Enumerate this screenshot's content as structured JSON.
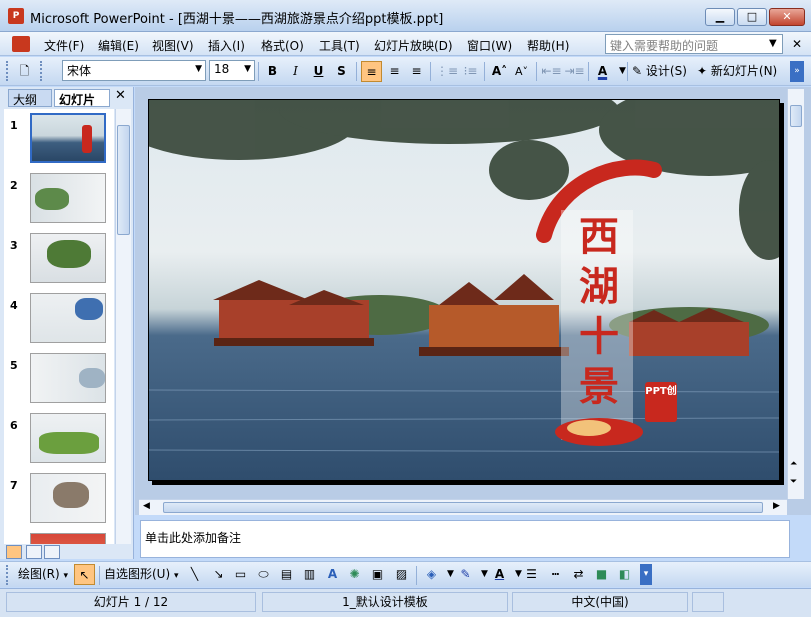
{
  "window": {
    "title": "Microsoft PowerPoint - [西湖十景——西湖旅游景点介绍ppt模板.ppt]",
    "app_icon": "P",
    "minimize": "▁",
    "maximize": "□",
    "close": "✕"
  },
  "menu": {
    "items": [
      "文件(F)",
      "编辑(E)",
      "视图(V)",
      "插入(I)",
      "格式(O)",
      "工具(T)",
      "幻灯片放映(D)",
      "窗口(W)",
      "帮助(H)"
    ],
    "help_placeholder": "键入需要帮助的问题",
    "doc_close": "✕"
  },
  "format_toolbar": {
    "font": "宋体",
    "size": "18",
    "bold": "B",
    "italic": "I",
    "underline": "U",
    "shadow": "S",
    "design_label": "设计(S)",
    "new_slide_label": "新幻灯片(N)"
  },
  "panel": {
    "tab_outline": "大纲",
    "tab_slides": "幻灯片",
    "close": "✕",
    "thumbnails": [
      {
        "num": "1"
      },
      {
        "num": "2"
      },
      {
        "num": "3"
      },
      {
        "num": "4"
      },
      {
        "num": "5"
      },
      {
        "num": "6"
      },
      {
        "num": "7"
      }
    ]
  },
  "slide": {
    "title_chars": [
      "西",
      "湖",
      "十",
      "景"
    ],
    "badge": "PPT创"
  },
  "notes": {
    "placeholder": "单击此处添加备注"
  },
  "draw_toolbar": {
    "draw_label": "绘图(R)",
    "autoshape_label": "自选图形(U)"
  },
  "status": {
    "slide_info": "幻灯片 1 / 12",
    "template": "1_默认设计模板",
    "language": "中文(中国)"
  },
  "colors": {
    "accent_red": "#c8281e",
    "selection": "#316ac5"
  }
}
